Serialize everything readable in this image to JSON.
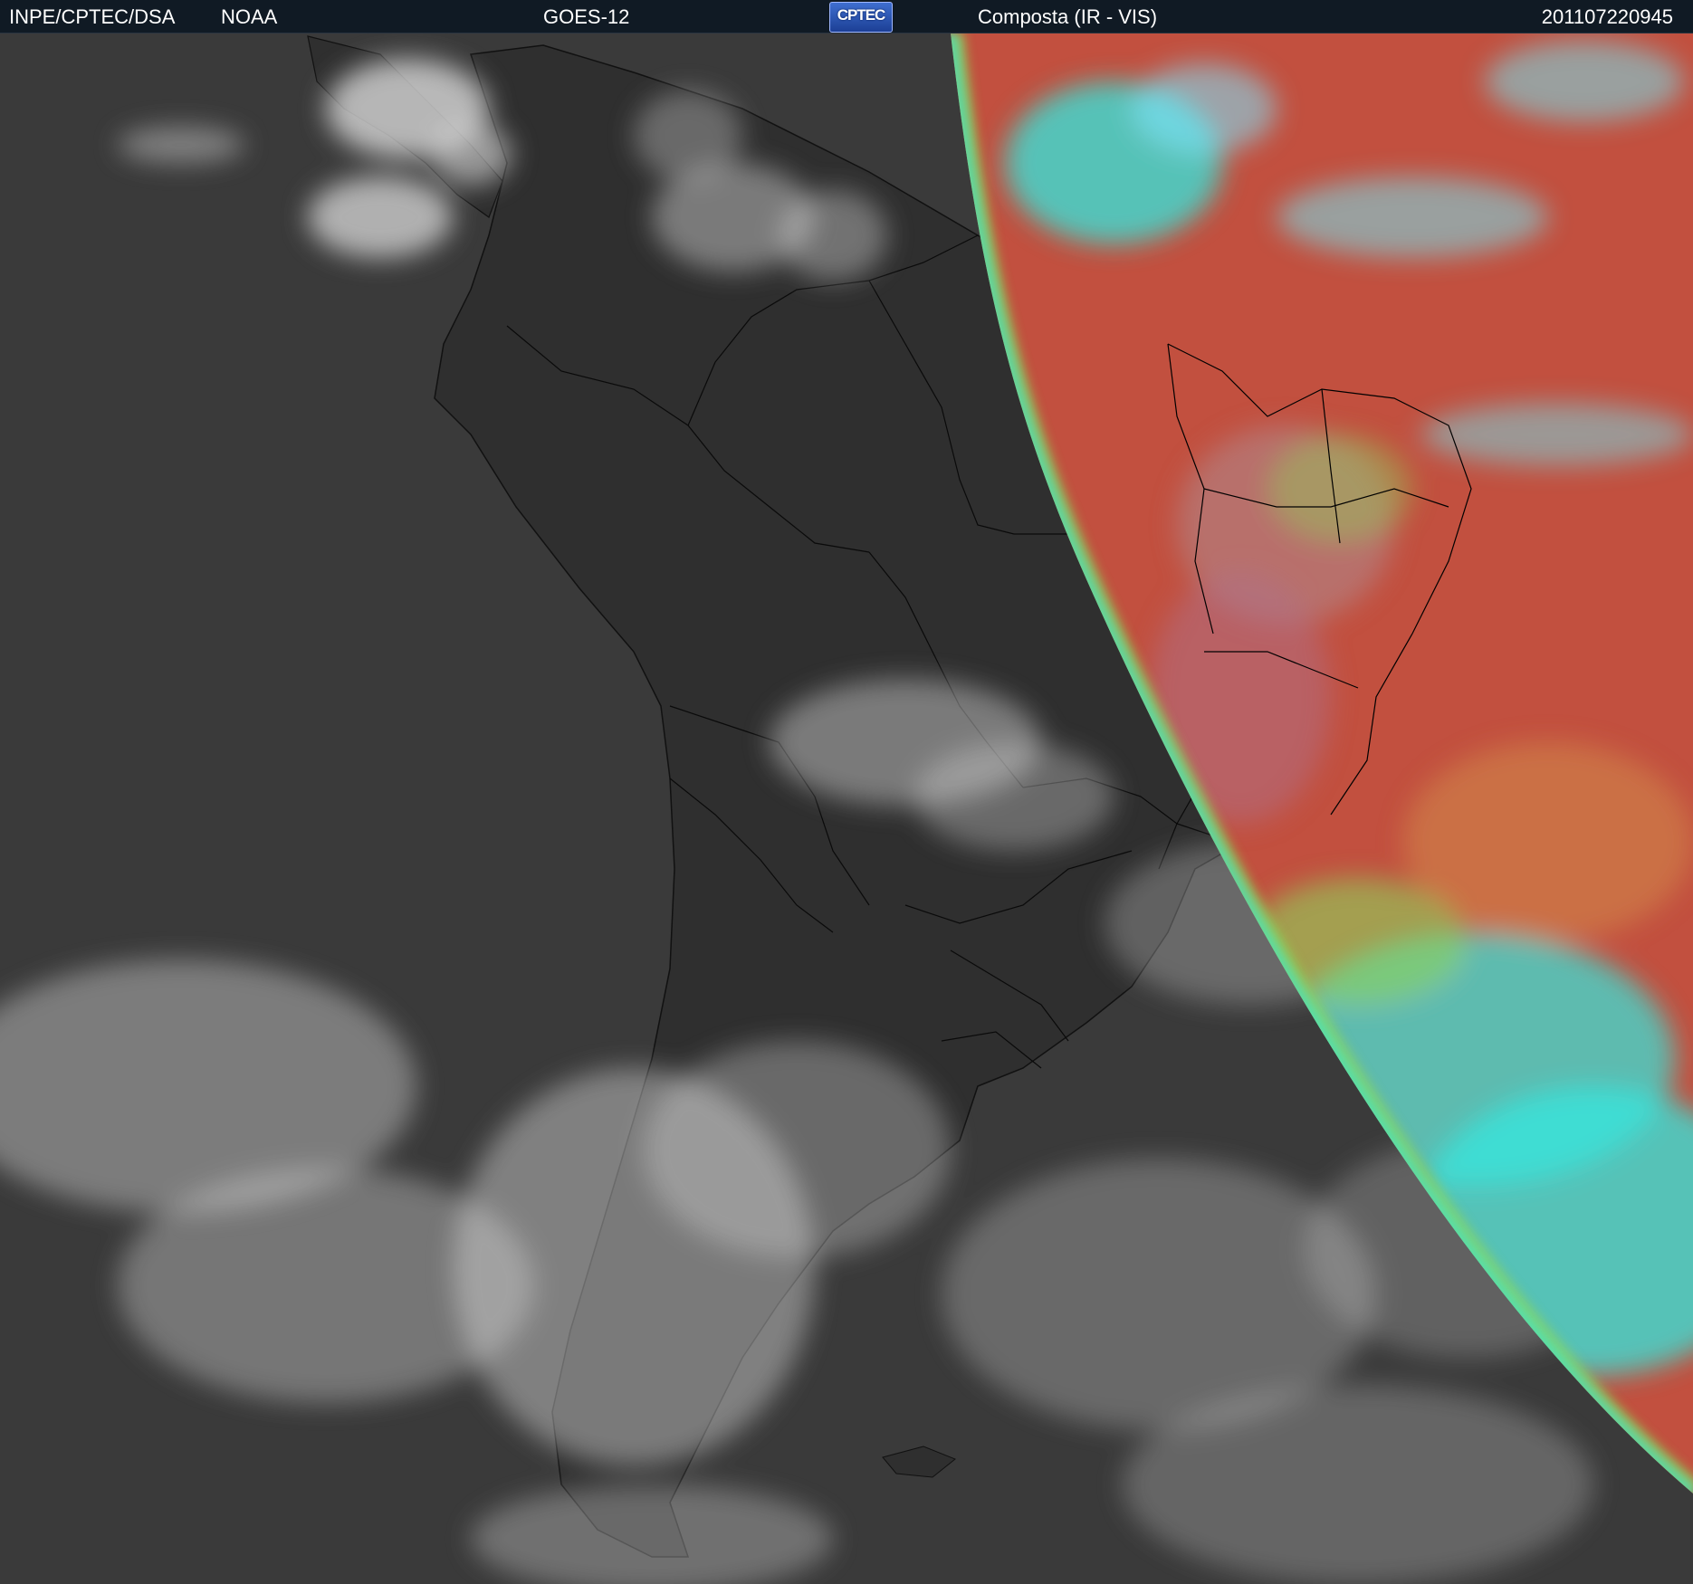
{
  "header": {
    "agency": "INPE/CPTEC/DSA",
    "provider": "NOAA",
    "satellite": "GOES-12",
    "logo_text": "CPTEC",
    "product": "Composta (IR - VIS)",
    "timestamp": "201107220945"
  },
  "colors": {
    "header_bg": "#101a24",
    "ocean_ir": "#3a3a3a",
    "land_ir": "#2f2f2f",
    "cloud": "#d8d8d8",
    "day_side": "#c2503f",
    "coast_bright": "#33e8e0",
    "terminator_green": "#8fd45a",
    "border_line": "#000000"
  },
  "icons": {
    "logo": "cptec-logo"
  }
}
